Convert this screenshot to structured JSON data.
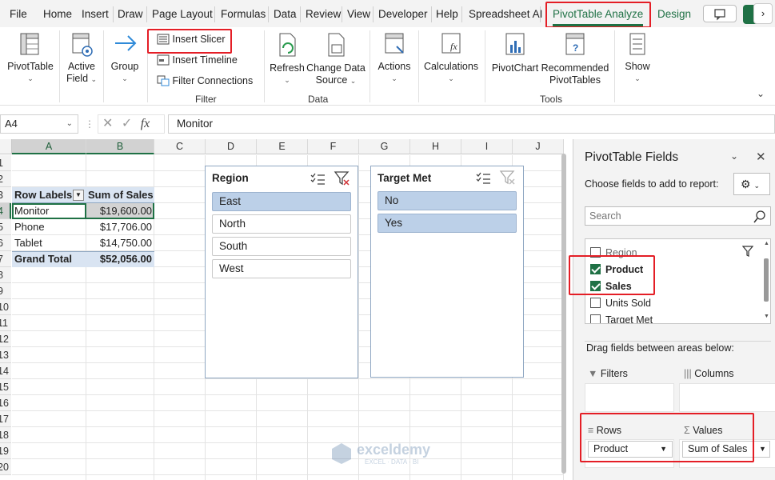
{
  "tabs": [
    "File",
    "Home",
    "Insert",
    "Draw",
    "Page Layout",
    "Formulas",
    "Data",
    "Review",
    "View",
    "Developer",
    "Help",
    "Spreadsheet AI",
    "PivotTable Analyze",
    "Design"
  ],
  "ribbon": {
    "pivottable": "PivotTable",
    "active_field_1": "Active",
    "active_field_2": "Field",
    "group": "Group",
    "insert_slicer": "Insert Slicer",
    "insert_timeline": "Insert Timeline",
    "filter_connections": "Filter Connections",
    "filter_group": "Filter",
    "refresh": "Refresh",
    "change_data_source_1": "Change Data",
    "change_data_source_2": "Source",
    "data_group": "Data",
    "actions": "Actions",
    "calculations": "Calculations",
    "pivotchart": "PivotChart",
    "recommended_1": "Recommended",
    "recommended_2": "PivotTables",
    "tools_group": "Tools",
    "show": "Show"
  },
  "formula_bar": {
    "name_box": "A4",
    "fx": "fx",
    "value": "Monitor"
  },
  "columns": [
    "A",
    "B",
    "C",
    "D",
    "E",
    "F",
    "G",
    "H",
    "I",
    "J"
  ],
  "rows": [
    "1",
    "2",
    "3",
    "4",
    "5",
    "6",
    "7",
    "8",
    "9",
    "10",
    "11",
    "12",
    "13",
    "14",
    "15",
    "16",
    "17",
    "18",
    "19",
    "20"
  ],
  "pivot": {
    "header_label": "Row Labels",
    "header_value": "Sum of Sales",
    "rows": [
      {
        "label": "Monitor",
        "value": "$19,600.00"
      },
      {
        "label": "Phone",
        "value": "$17,706.00"
      },
      {
        "label": "Tablet",
        "value": "$14,750.00"
      }
    ],
    "total_label": "Grand Total",
    "total_value": "$52,056.00"
  },
  "slicer_region": {
    "title": "Region",
    "items": [
      "East",
      "North",
      "South",
      "West"
    ]
  },
  "slicer_target": {
    "title": "Target Met",
    "items": [
      "No",
      "Yes"
    ]
  },
  "watermark": {
    "name": "exceldemy",
    "tag": "EXCEL · DATA · BI"
  },
  "pane": {
    "title": "PivotTable Fields",
    "subtitle": "Choose fields to add to report:",
    "search_placeholder": "Search",
    "fields": [
      {
        "name": "Region",
        "checked": false
      },
      {
        "name": "Product",
        "checked": true
      },
      {
        "name": "Sales",
        "checked": true
      },
      {
        "name": "Units Sold",
        "checked": false
      },
      {
        "name": "Target Met",
        "checked": false
      }
    ],
    "drag_label": "Drag fields between areas below:",
    "filters": "Filters",
    "columns": "Columns",
    "rows_label": "Rows",
    "values_label": "Values",
    "rows_value": "Product",
    "values_value": "Sum of Sales"
  },
  "colors": {
    "accent": "#1f7145",
    "highlight": "#e41e26",
    "slicer_selected": "#bcd0e8"
  }
}
